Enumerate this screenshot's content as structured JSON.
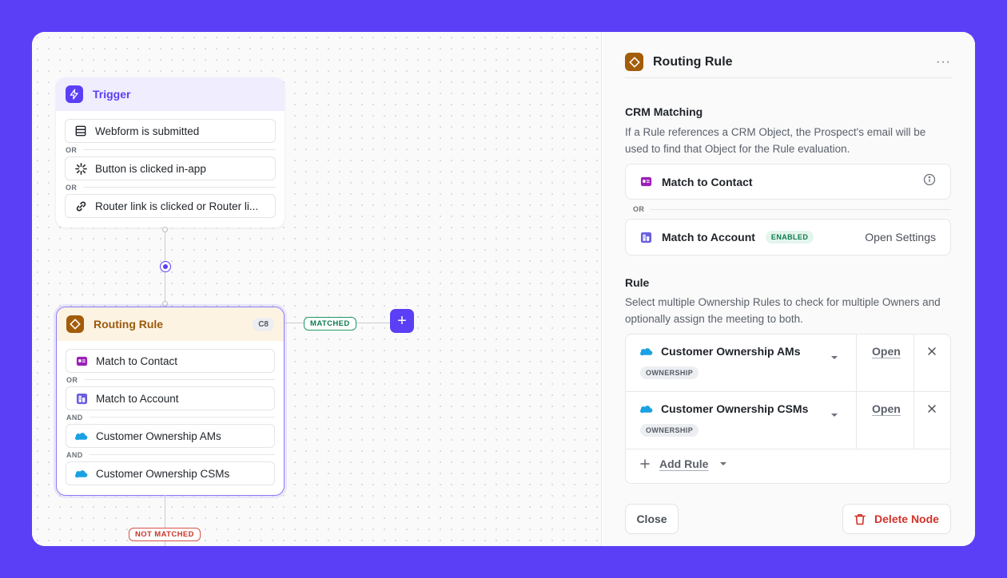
{
  "canvas": {
    "trigger_node": {
      "title": "Trigger",
      "items": [
        {
          "label": "Webform is submitted",
          "icon": "form-icon"
        },
        {
          "label": "Button is clicked in-app",
          "icon": "click-icon"
        },
        {
          "label": "Router link is clicked or Router li...",
          "icon": "link-icon"
        }
      ],
      "separators": [
        "OR",
        "OR"
      ]
    },
    "routing_node": {
      "title": "Routing Rule",
      "badge": "C8",
      "items": [
        {
          "label": "Match to Contact",
          "icon": "contact-card-icon"
        },
        {
          "label": "Match to Account",
          "icon": "account-building-icon"
        },
        {
          "label": "Customer Ownership AMs",
          "icon": "salesforce-cloud-icon"
        },
        {
          "label": "Customer Ownership CSMs",
          "icon": "salesforce-cloud-icon"
        }
      ],
      "separators": [
        "OR",
        "AND",
        "AND"
      ]
    },
    "matched_label": "MATCHED",
    "not_matched_label": "NOT MATCHED",
    "add_button": "+"
  },
  "panel": {
    "title": "Routing Rule",
    "more": "···",
    "crm": {
      "title": "CRM Matching",
      "description": "If a Rule references a CRM Object, the Prospect's email will be used to find that Object for the Rule evaluation.",
      "contact_label": "Match to Contact",
      "or_label": "OR",
      "account_label": "Match to Account",
      "account_status": "ENABLED",
      "open_settings": "Open Settings"
    },
    "rule": {
      "title": "Rule",
      "description": "Select multiple Ownership Rules to check for multiple Owners and optionally assign the meeting to both.",
      "rules": [
        {
          "name": "Customer Ownership AMs",
          "badge": "OWNERSHIP",
          "open": "Open"
        },
        {
          "name": "Customer Ownership CSMs",
          "badge": "OWNERSHIP",
          "open": "Open"
        }
      ],
      "add_rule": "Add Rule"
    },
    "footer": {
      "close": "Close",
      "delete": "Delete Node"
    }
  },
  "colors": {
    "background": "#5b3ff6",
    "accent": "#5b3ff6",
    "routing_icon": "#a35c0a",
    "success": "#0f7b4f",
    "danger": "#d1342a"
  }
}
